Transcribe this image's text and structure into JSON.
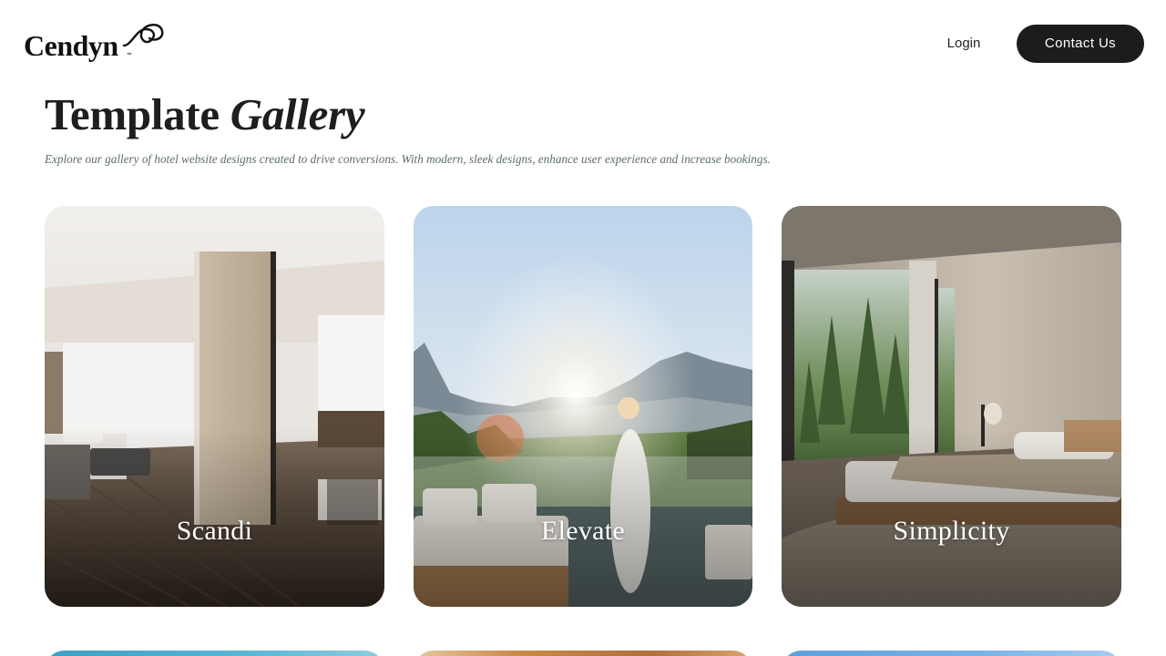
{
  "header": {
    "logo_text": "Cendyn",
    "logo_tm": "™",
    "login_label": "Login",
    "contact_label": "Contact Us"
  },
  "page": {
    "title_plain": "Template ",
    "title_italic": "Gallery",
    "subtitle": "Explore our gallery of hotel website designs created to drive conversions. With modern, sleek designs, enhance user experience and increase bookings."
  },
  "gallery": {
    "items": [
      {
        "label": "Scandi"
      },
      {
        "label": "Elevate"
      },
      {
        "label": "Simplicity"
      }
    ]
  }
}
